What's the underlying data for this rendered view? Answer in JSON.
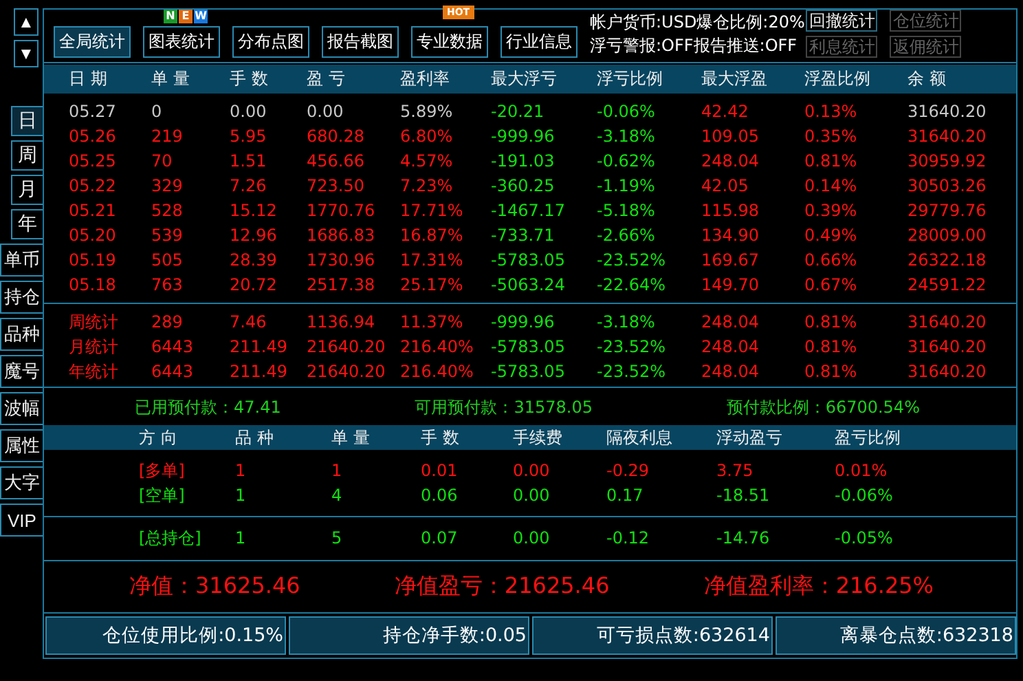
{
  "nav_arrows": [
    "▲",
    "▼"
  ],
  "toolbar": {
    "buttons": [
      {
        "label": "全局统计",
        "selected": true,
        "kind": "plain"
      },
      {
        "label": "图表统计",
        "selected": false,
        "kind": "new"
      },
      {
        "label": "分布点图",
        "selected": false,
        "kind": "plain"
      },
      {
        "label": "报告截图",
        "selected": false,
        "kind": "plain"
      },
      {
        "label": "专业数据",
        "selected": false,
        "kind": "hot"
      },
      {
        "label": "行业信息",
        "selected": false,
        "kind": "plain"
      }
    ],
    "new_letters": [
      "N",
      "E",
      "W"
    ],
    "hot_label": "HOT",
    "info": [
      "帐户货币:USD爆仓比例:20%",
      "浮亏警报:OFF报告推送:OFF"
    ],
    "side_buttons": [
      {
        "label": "回撤统计",
        "disabled": false
      },
      {
        "label": "仓位统计",
        "disabled": true
      },
      {
        "label": "利息统计",
        "disabled": true
      },
      {
        "label": "返佣统计",
        "disabled": true
      }
    ]
  },
  "sidebar": {
    "period_tabs": [
      {
        "label": "日",
        "selected": true
      },
      {
        "label": "周",
        "selected": false
      },
      {
        "label": "月",
        "selected": false
      },
      {
        "label": "年",
        "selected": false
      }
    ],
    "items": [
      "单币",
      "持仓",
      "品种",
      "魔号",
      "波幅",
      "属性",
      "大字",
      "VIP"
    ]
  },
  "table": {
    "columns": [
      {
        "label": "日 期",
        "kind": "row"
      },
      {
        "label": "单 量",
        "kind": "row"
      },
      {
        "label": "手 数",
        "kind": "row"
      },
      {
        "label": "盈 亏",
        "kind": "row"
      },
      {
        "label": "盈利率",
        "kind": "row"
      },
      {
        "label": "最大浮亏",
        "kind": "loss"
      },
      {
        "label": "浮亏比例",
        "kind": "loss"
      },
      {
        "label": "最大浮盈",
        "kind": "gain"
      },
      {
        "label": "浮盈比例",
        "kind": "gain"
      },
      {
        "label": "余 额",
        "kind": "row"
      }
    ],
    "rows": [
      {
        "kind": "flat",
        "cells": [
          "05.27",
          "0",
          "0.00",
          "0.00",
          "5.89%",
          "-20.21",
          "-0.06%",
          "42.42",
          "0.13%",
          "31640.20"
        ]
      },
      {
        "kind": "profit",
        "cells": [
          "05.26",
          "219",
          "5.95",
          "680.28",
          "6.80%",
          "-999.96",
          "-3.18%",
          "109.05",
          "0.35%",
          "31640.20"
        ]
      },
      {
        "kind": "profit",
        "cells": [
          "05.25",
          "70",
          "1.51",
          "456.66",
          "4.57%",
          "-191.03",
          "-0.62%",
          "248.04",
          "0.81%",
          "30959.92"
        ]
      },
      {
        "kind": "profit",
        "cells": [
          "05.22",
          "329",
          "7.26",
          "723.50",
          "7.23%",
          "-360.25",
          "-1.19%",
          "42.05",
          "0.14%",
          "30503.26"
        ]
      },
      {
        "kind": "profit",
        "cells": [
          "05.21",
          "528",
          "15.12",
          "1770.76",
          "17.71%",
          "-1467.17",
          "-5.18%",
          "115.98",
          "0.39%",
          "29779.76"
        ]
      },
      {
        "kind": "profit",
        "cells": [
          "05.20",
          "539",
          "12.96",
          "1686.83",
          "16.87%",
          "-733.71",
          "-2.66%",
          "134.90",
          "0.49%",
          "28009.00"
        ]
      },
      {
        "kind": "profit",
        "cells": [
          "05.19",
          "505",
          "28.39",
          "1730.96",
          "17.31%",
          "-5783.05",
          "-23.52%",
          "169.67",
          "0.66%",
          "26322.18"
        ]
      },
      {
        "kind": "profit",
        "cells": [
          "05.18",
          "763",
          "20.72",
          "2517.38",
          "25.17%",
          "-5063.24",
          "-22.64%",
          "149.70",
          "0.67%",
          "24591.22"
        ]
      }
    ],
    "summary_rows": [
      {
        "kind": "profit",
        "cells": [
          "周统计",
          "289",
          "7.46",
          "1136.94",
          "11.37%",
          "-999.96",
          "-3.18%",
          "248.04",
          "0.81%",
          "31640.20"
        ]
      },
      {
        "kind": "profit",
        "cells": [
          "月统计",
          "6443",
          "211.49",
          "21640.20",
          "216.40%",
          "-5783.05",
          "-23.52%",
          "248.04",
          "0.81%",
          "31640.20"
        ]
      },
      {
        "kind": "profit",
        "cells": [
          "年统计",
          "6443",
          "211.49",
          "21640.20",
          "216.40%",
          "-5783.05",
          "-23.52%",
          "248.04",
          "0.81%",
          "31640.20"
        ]
      }
    ]
  },
  "prepay": [
    "已用预付款：47.41",
    "可用预付款：31578.05",
    "预付款比例：66700.54%"
  ],
  "positions": {
    "columns": [
      "方 向",
      "品 种",
      "单 量",
      "手 数",
      "手续费",
      "隔夜利息",
      "浮动盈亏",
      "盈亏比例"
    ],
    "rows": [
      {
        "kind": "long",
        "cells": [
          "[多单]",
          "1",
          "1",
          "0.01",
          "0.00",
          "-0.29",
          "3.75",
          "0.01%"
        ]
      },
      {
        "kind": "short",
        "cells": [
          "[空单]",
          "1",
          "4",
          "0.06",
          "0.00",
          "0.17",
          "-18.51",
          "-0.06%"
        ]
      }
    ],
    "total": {
      "kind": "short",
      "cells": [
        "[总持仓]",
        "1",
        "5",
        "0.07",
        "0.00",
        "-0.12",
        "-14.76",
        "-0.05%"
      ]
    }
  },
  "equity": [
    "净值：31625.46",
    "净值盈亏：21625.46",
    "净值盈利率：216.25%"
  ],
  "status_bar": [
    "仓位使用比例:0.15%",
    "持仓净手数:0.05",
    "可亏损点数:632614",
    "离暴仓点数:632318"
  ]
}
